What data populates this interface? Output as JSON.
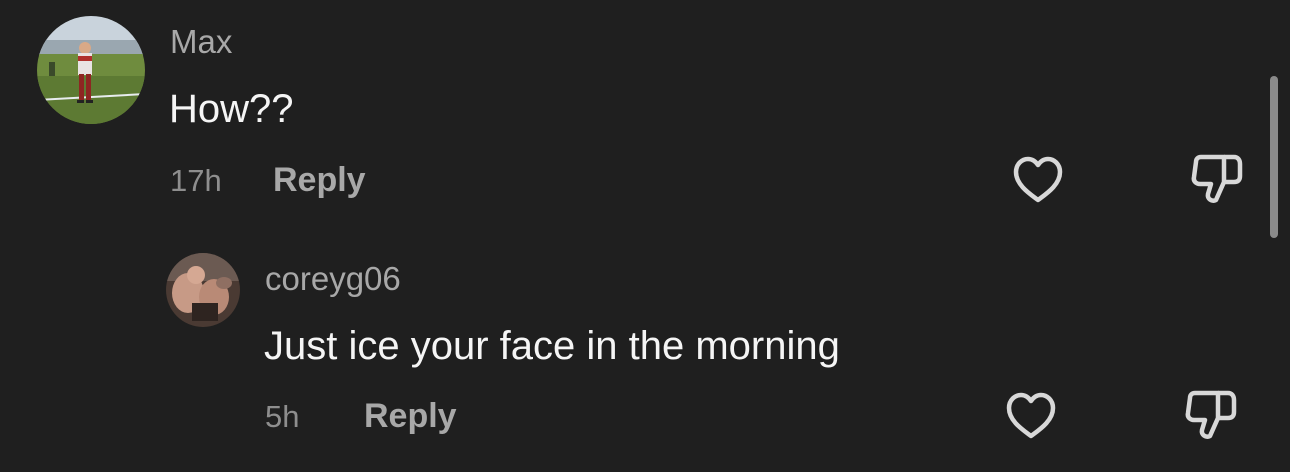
{
  "colors": {
    "background": "#1f1f1f",
    "username": "#a8a8a8",
    "body_text": "#f5f5f5",
    "meta_text": "#8e8e8e",
    "icon": "#d8d8d8"
  },
  "comments": [
    {
      "username": "Max",
      "text": "How??",
      "time": "17h",
      "reply_label": "Reply",
      "like_icon": "heart-outline-icon",
      "dislike_icon": "thumbs-down-icon"
    },
    {
      "username": "coreyg06",
      "text": "Just ice your face in the morning",
      "time": "5h",
      "reply_label": "Reply",
      "like_icon": "heart-outline-icon",
      "dislike_icon": "thumbs-down-icon"
    }
  ]
}
